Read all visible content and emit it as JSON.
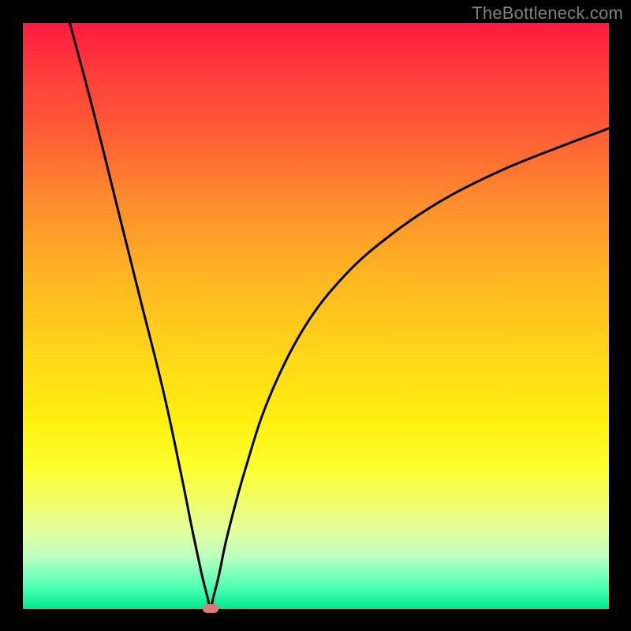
{
  "watermark": "TheBottleneck.com",
  "colors": {
    "frame": "#000000",
    "curve": "#000000",
    "marker": "#d97c76",
    "gradient_top": "#ff1a3f",
    "gradient_bottom": "#00e58c"
  },
  "chart_data": {
    "type": "line",
    "title": "",
    "xlabel": "",
    "ylabel": "",
    "xlim": [
      0,
      100
    ],
    "ylim": [
      0,
      100
    ],
    "grid": false,
    "series": [
      {
        "name": "bottleneck-curve",
        "x": [
          8,
          12,
          16,
          20,
          24,
          27,
          29,
          30.5,
          31.5,
          32,
          32.5,
          33.5,
          35,
          38,
          42,
          48,
          55,
          63,
          72,
          82,
          92,
          100
        ],
        "y": [
          100,
          85,
          69,
          53,
          37,
          23,
          13,
          6,
          2,
          0,
          2,
          6,
          13,
          24,
          36,
          48,
          57,
          64,
          70,
          75,
          79,
          82
        ]
      }
    ],
    "markers": [
      {
        "name": "bottleneck-point",
        "x": 32,
        "y": 0
      }
    ],
    "annotations": []
  }
}
